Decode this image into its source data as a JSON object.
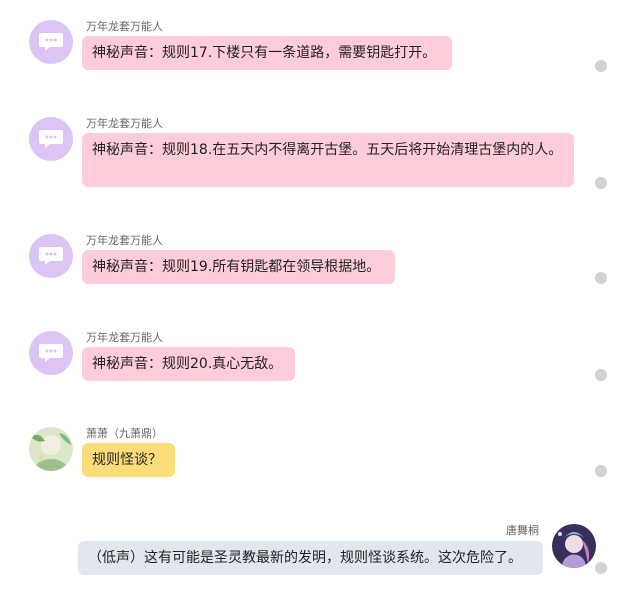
{
  "messages": [
    {
      "sender": "万年龙套万能人",
      "text": "神秘声音：规则17.下楼只有一条道路，需要钥匙打开。"
    },
    {
      "sender": "万年龙套万能人",
      "text": "神秘声音：规则18.在五天内不得离开古堡。五天后将开始清理古堡内的人。"
    },
    {
      "sender": "万年龙套万能人",
      "text": "神秘声音：规则19.所有钥匙都在领导根据地。"
    },
    {
      "sender": "万年龙套万能人",
      "text": "神秘声音：规则20.真心无敌。"
    },
    {
      "sender": "萧萧（九萧鼎）",
      "text": "规则怪谈？"
    },
    {
      "sender": "唐舞桐",
      "text": "（低声）这有可能是圣灵教最新的发明，规则怪谈系统。这次危险了。"
    }
  ],
  "colors": {
    "bubble_pink": "#fecdd9",
    "bubble_yellow": "#fddd79",
    "bubble_gray": "#e2e6ef",
    "avatar_purple": "#dcc4f5"
  },
  "icons": {
    "bot_avatar": "chat-bubble-icon",
    "status_dot": "status-dot"
  }
}
